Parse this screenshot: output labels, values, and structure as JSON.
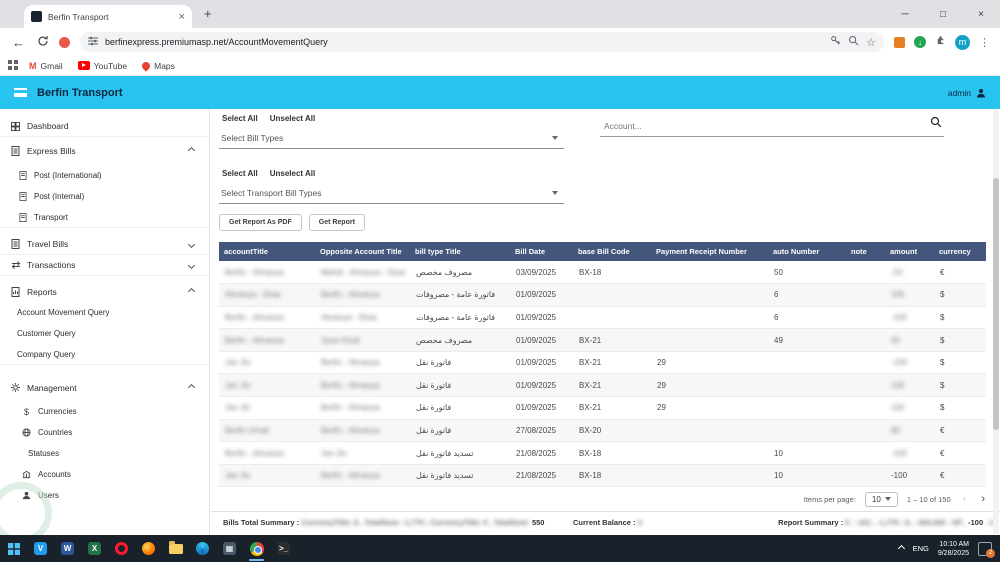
{
  "browser": {
    "tab_title": "Berfin Transport",
    "url": "berfinexpress.premiumasp.net/AccountMovementQuery",
    "profile_initial": "m",
    "bookmarks": [
      {
        "label": "Gmail"
      },
      {
        "label": "YouTube"
      },
      {
        "label": "Maps"
      }
    ]
  },
  "header": {
    "title": "Berfin Transport",
    "user": "admin"
  },
  "sidebar": {
    "items": [
      {
        "label": "Dashboard"
      },
      {
        "label": "Express Bills"
      },
      {
        "label": "Post (International)"
      },
      {
        "label": "Post (Internal)"
      },
      {
        "label": "Transport"
      },
      {
        "label": "Travel Bills"
      },
      {
        "label": "Transactions"
      },
      {
        "label": "Reports"
      },
      {
        "label": "Account Movement Query"
      },
      {
        "label": "Customer Query"
      },
      {
        "label": "Company Query"
      },
      {
        "label": "Management"
      },
      {
        "label": "Currencies"
      },
      {
        "label": "Countries"
      },
      {
        "label": "Statuses"
      },
      {
        "label": "Accounts"
      },
      {
        "label": "Users"
      }
    ]
  },
  "filters": {
    "select_all": "Select All",
    "unselect_all": "Unselect All",
    "bill_types_placeholder": "Select Bill Types",
    "transport_bill_types_placeholder": "Select Transport Bill Types",
    "account_placeholder": "Account..."
  },
  "actions": {
    "get_pdf": "Get Report As PDF",
    "get_report": "Get Report"
  },
  "table": {
    "columns": [
      "accountTitle",
      "Opposite Account Title",
      "bill type Title",
      "Bill Date",
      "base Bill Code",
      "Payment Receipt Number",
      "auto Number",
      "note",
      "amount",
      "currency"
    ],
    "column_keys": [
      "accountTitle",
      "oppositeAccountTitle",
      "billTypeTitle",
      "billDate",
      "baseBillCode",
      "paymentReceiptNumber",
      "autoNumber",
      "note",
      "amount",
      "currency"
    ],
    "rows": [
      {
        "cells": [
          "Berfin - Almanya",
          "Mahdi - Almanya - Ekas",
          "مصروف مخصص",
          "03/09/2025",
          "BX-18",
          "",
          "50",
          "",
          "-50",
          "€"
        ],
        "blur": [
          1,
          1,
          0,
          0,
          0,
          0,
          0,
          0,
          1,
          0
        ]
      },
      {
        "cells": [
          "Almanya - Ekas",
          "Berfin - Almanya",
          "فاتورة عامة - مصروفات",
          "01/09/2025",
          "",
          "",
          "6",
          "",
          "100",
          "$"
        ],
        "blur": [
          1,
          1,
          0,
          0,
          0,
          0,
          0,
          0,
          1,
          0
        ]
      },
      {
        "cells": [
          "Berfin - Almanya",
          "Almanya - Ekas",
          "فاتورة عامة - مصروفات",
          "01/09/2025",
          "",
          "",
          "6",
          "",
          "-100",
          "$"
        ],
        "blur": [
          1,
          1,
          0,
          0,
          0,
          0,
          0,
          0,
          1,
          0
        ]
      },
      {
        "cells": [
          "Berfin - Almanya",
          "Jiyan Kholi",
          "مصروف مخصص",
          "01/09/2025",
          "BX-21",
          "",
          "49",
          "",
          "30",
          "$"
        ],
        "blur": [
          1,
          1,
          0,
          0,
          0,
          0,
          0,
          0,
          1,
          0
        ]
      },
      {
        "cells": [
          "Jan Jlo",
          "Berfin - Almanya",
          "فاتورة نقل",
          "01/09/2025",
          "BX-21",
          "29",
          "",
          "",
          "-100",
          "$"
        ],
        "blur": [
          1,
          1,
          0,
          0,
          0,
          0,
          0,
          0,
          1,
          0
        ]
      },
      {
        "cells": [
          "Jan Jlo",
          "Berfin - Almanya",
          "فاتورة نقل",
          "01/09/2025",
          "BX-21",
          "29",
          "",
          "",
          "100",
          "$"
        ],
        "blur": [
          1,
          1,
          0,
          0,
          0,
          0,
          0,
          0,
          1,
          0
        ]
      },
      {
        "cells": [
          "Jan Jlo",
          "Berfin - Almanya",
          "فاتورة نقل",
          "01/09/2025",
          "BX-21",
          "29",
          "",
          "",
          "100",
          "$"
        ],
        "blur": [
          1,
          1,
          0,
          0,
          0,
          0,
          0,
          0,
          1,
          0
        ]
      },
      {
        "cells": [
          "Berfin Umait",
          "Berfin - Almanya",
          "فاتورة نقل",
          "27/08/2025",
          "BX-20",
          "",
          "",
          "",
          "80",
          "€"
        ],
        "blur": [
          1,
          1,
          0,
          0,
          0,
          0,
          0,
          0,
          1,
          0
        ]
      },
      {
        "cells": [
          "Berfin - Almanya",
          "Jan Jlo",
          "تسديد فاتورة نقل",
          "21/08/2025",
          "BX-18",
          "",
          "10",
          "",
          "-100",
          "€"
        ],
        "blur": [
          1,
          1,
          0,
          0,
          0,
          0,
          0,
          0,
          1,
          0
        ]
      },
      {
        "cells": [
          "Jan Jlo",
          "Berfin - Almanya",
          "تسديد فاتورة نقل",
          "21/08/2025",
          "BX-18",
          "",
          "10",
          "",
          "-100",
          "€"
        ],
        "blur": [
          1,
          1,
          0,
          0,
          0,
          0,
          0,
          0,
          0,
          0
        ]
      }
    ]
  },
  "pagination": {
    "items_per_page_label": "Items per page:",
    "page_size": "10",
    "range_label": "1 – 10 of 150"
  },
  "summary_lines": {
    "bills": [
      {
        "t": "Bills Total Summary : ",
        "b": 0
      },
      {
        "t": "CurrencyTitle: $ , TotalSum: -1,775 ; CurrencyTitle: € , TotalSum: ",
        "b": 1
      },
      {
        "t": "550",
        "b": 0
      }
    ],
    "balance": [
      {
        "t": "Current Balance : ",
        "b": 0
      },
      {
        "t": "0",
        "b": 1
      }
    ],
    "report": [
      {
        "t": "Report Summary : ",
        "b": 0
      },
      {
        "t": "€ : -101 , -1,775 : $ , -300,000 : SP , ",
        "b": 1
      },
      {
        "t": "-100",
        "b": 0
      },
      {
        "t": " : 4",
        "b": 1
      }
    ]
  },
  "taskbar": {
    "lang": "ENG",
    "time": "10:10 AM",
    "date": "9/28/2025",
    "badge": "2"
  }
}
